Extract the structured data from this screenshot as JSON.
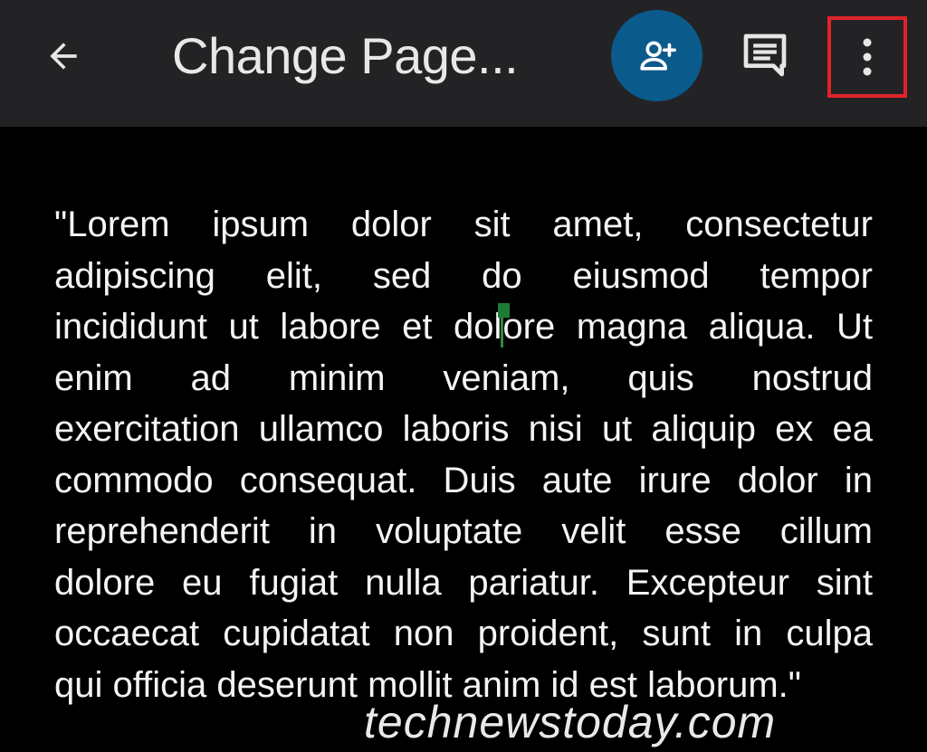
{
  "app_bar": {
    "back_icon": "arrow-left-icon",
    "title": "Change Page...",
    "share_icon": "person-add-icon",
    "share_color": "#0b5a8c",
    "comment_icon": "comment-icon",
    "more_icon": "more-vert-icon",
    "highlight_color": "#e0232a"
  },
  "document": {
    "lines": [
      "\"Lorem ipsum dolor sit amet, consectetur",
      "adipiscing elit, sed do eiusmod tempor",
      "incididunt ut labore et dolore magna aliqua. Ut",
      "enim ad minim veniam, quis nostrud",
      "exercitation ullamco laboris nisi ut aliquip ex ea",
      "commodo consequat. Duis aute irure dolor in",
      "reprehenderit in voluptate velit esse cillum",
      "dolore eu fugiat nulla pariatur. Excepteur sint",
      "occaecat cupidatat non proident, sunt in culpa",
      "qui officia deserunt mollit anim id est laborum.\""
    ],
    "cursor_line_parts": [
      "incididunt ut labore et dol",
      "ore magna aliqua. Ut"
    ],
    "cursor_color": "#2e8b3a"
  },
  "watermark": "technewstoday.com"
}
